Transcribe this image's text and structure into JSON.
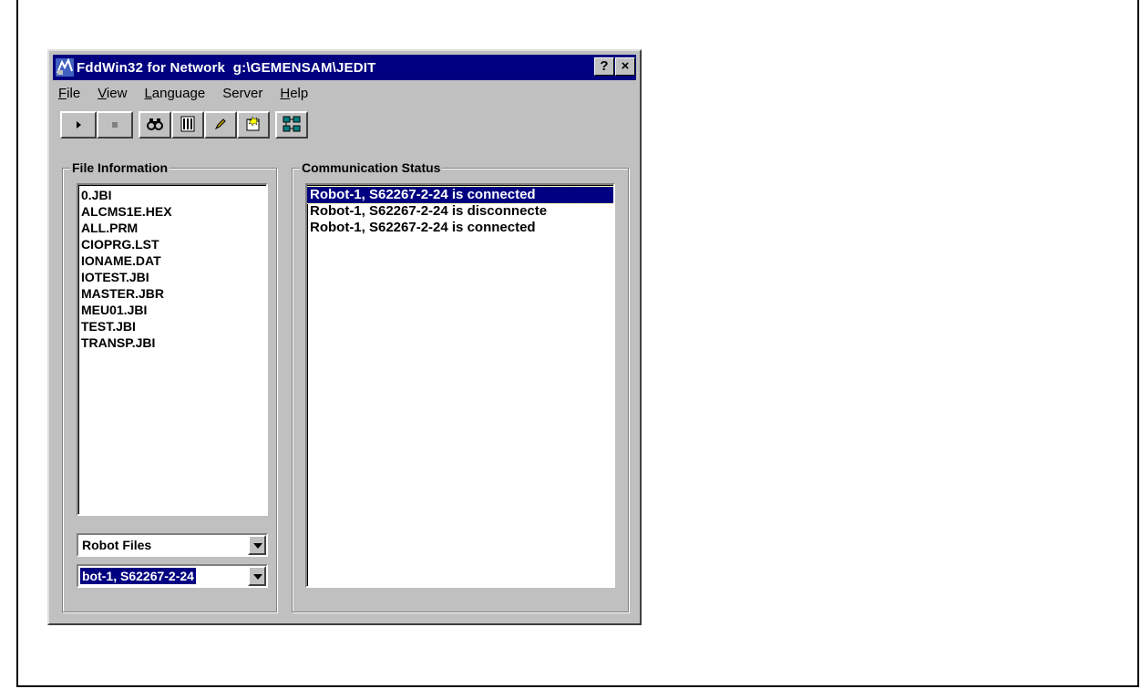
{
  "window": {
    "title": "FddWin32 for Network  g:\\GEMENSAM\\JEDIT",
    "help_button": "?",
    "close_button": "×"
  },
  "menu": [
    {
      "label": "File",
      "mnemonic": "F",
      "rest": "ile"
    },
    {
      "label": "View",
      "mnemonic": "V",
      "rest": "iew"
    },
    {
      "label": "Language",
      "mnemonic": "L",
      "rest": "anguage"
    },
    {
      "label": "Server",
      "mnemonic": "",
      "rest": "Server"
    },
    {
      "label": "Help",
      "mnemonic": "H",
      "rest": "elp"
    }
  ],
  "toolbar": {
    "icons": [
      "play-icon",
      "stop-icon",
      "binoculars-icon",
      "list-icon",
      "pencil-icon",
      "open-folder-icon",
      "network-icon"
    ]
  },
  "file_info": {
    "label": "File Information",
    "files": [
      "0.JBI",
      "ALCMS1E.HEX",
      "ALL.PRM",
      "CIOPRG.LST",
      "IONAME.DAT",
      "IOTEST.JBI",
      "MASTER.JBR",
      "MEU01.JBI",
      "TEST.JBI",
      "TRANSP.JBI"
    ],
    "file_type_select": "Robot Files",
    "robot_select": "bot-1, S62267-2-24"
  },
  "comm_status": {
    "label": "Communication Status",
    "messages": [
      "Robot-1, S62267-2-24 is connected",
      "Robot-1, S62267-2-24 is disconnecte",
      "Robot-1, S62267-2-24 is connected"
    ]
  },
  "colors": {
    "titlebar": "#000080",
    "face": "#c0c0c0",
    "selection": "#000080"
  }
}
